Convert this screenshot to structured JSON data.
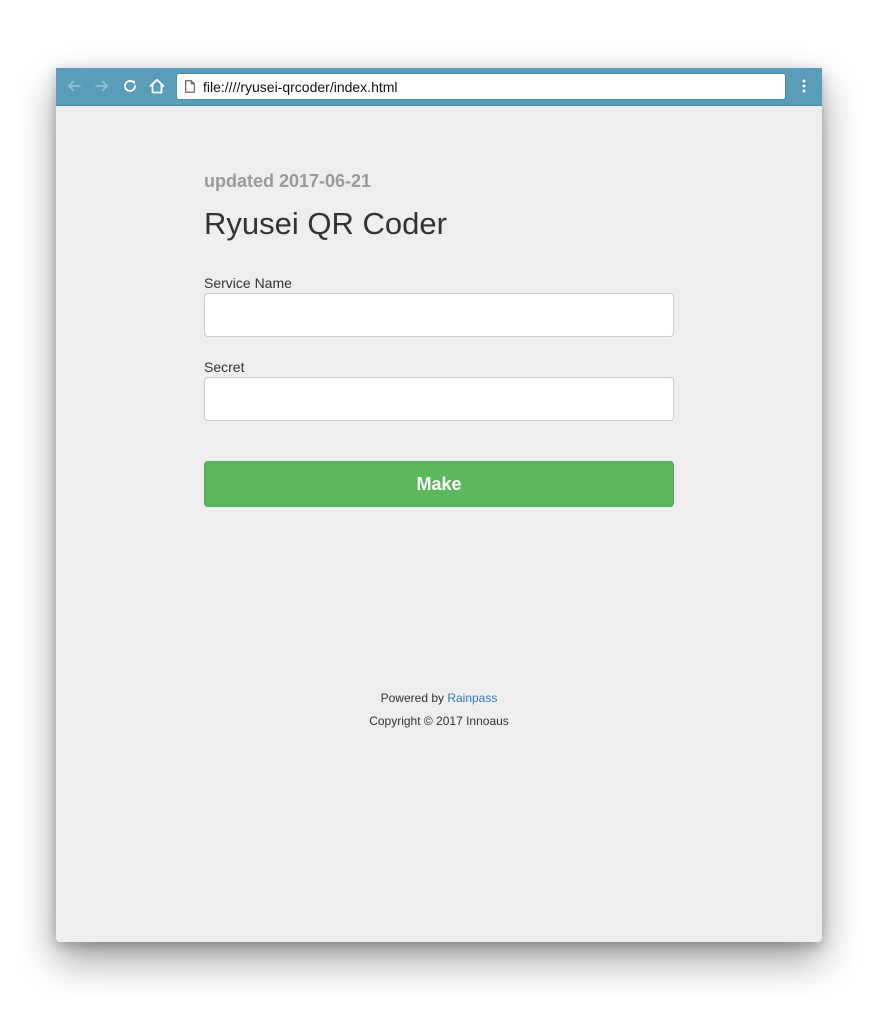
{
  "browser": {
    "url": "file:////ryusei-qrcoder/index.html",
    "icons": [
      "back-arrow-icon",
      "forward-arrow-icon",
      "reload-icon",
      "home-icon",
      "page-icon",
      "kebab-menu-icon"
    ]
  },
  "page": {
    "updated": "updated 2017-06-21",
    "title": "Ryusei QR Coder",
    "service_name": {
      "label": "Service Name",
      "value": "",
      "placeholder": ""
    },
    "secret": {
      "label": "Secret",
      "value": "",
      "placeholder": ""
    },
    "make_label": "Make"
  },
  "footer": {
    "powered_prefix": "Powered by ",
    "powered_link": "Rainpass",
    "copyright": "Copyright © 2017 Innoaus"
  },
  "colors": {
    "toolbar": "#5b9cb8",
    "button": "#5cb85c",
    "link": "#337ab7",
    "background": "#eeeeee"
  }
}
